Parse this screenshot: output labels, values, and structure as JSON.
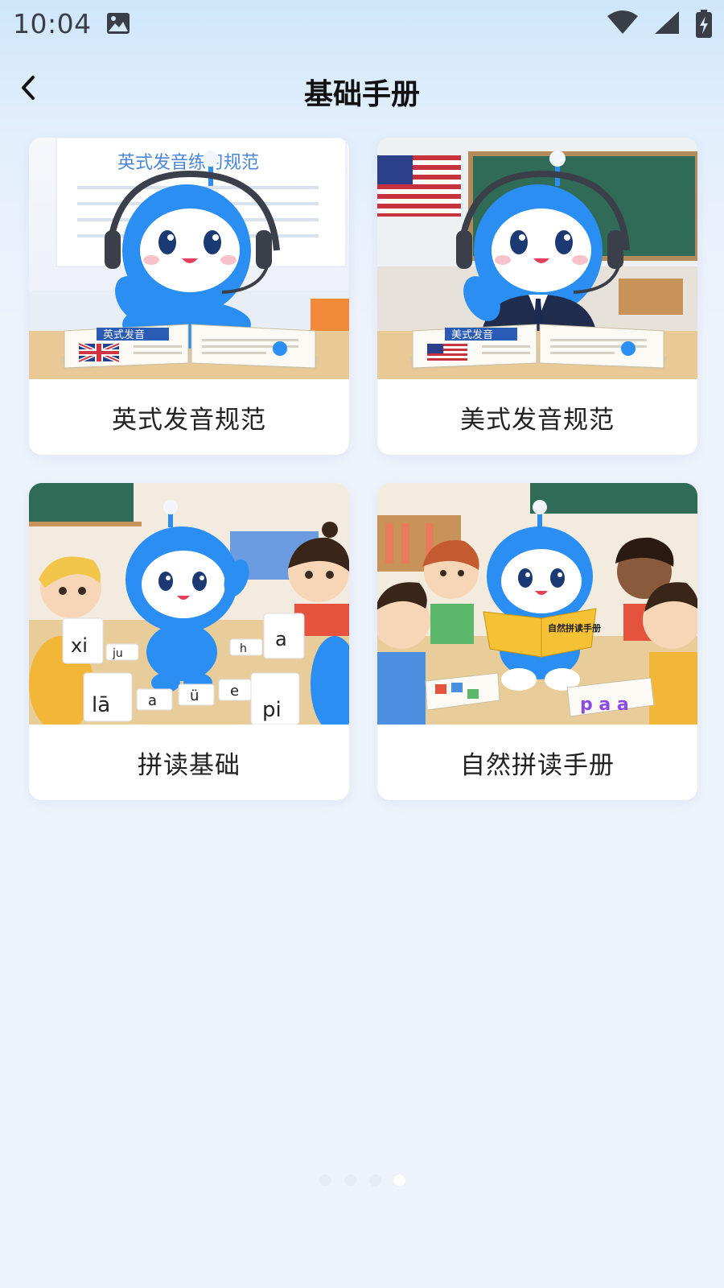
{
  "status_bar": {
    "time": "10:04",
    "icons": [
      "image-icon",
      "wifi-icon",
      "signal-icon",
      "battery-charging-icon"
    ]
  },
  "header": {
    "back_icon": "chevron-left-icon",
    "title": "基础手册"
  },
  "cards": [
    {
      "label": "英式发音规范",
      "image_text": {
        "title": "英式发音练习规范",
        "book_title": "英式发音"
      },
      "image_desc": "british-pronunciation-robot"
    },
    {
      "label": "美式发音规范",
      "image_text": {
        "book_title": "美式发音"
      },
      "image_desc": "american-pronunciation-robot"
    },
    {
      "label": "拼读基础",
      "image_text": {
        "cards": [
          "xi",
          "ju",
          "h",
          "a",
          "lā",
          "a",
          "ü",
          "e",
          "pi"
        ]
      },
      "image_desc": "pinyin-cards-robot"
    },
    {
      "label": "自然拼读手册",
      "image_text": {
        "book_title": "自然拼读手册",
        "letters": "p a a"
      },
      "image_desc": "phonics-reading-robot"
    }
  ],
  "pager": {
    "total": 4,
    "active_index": 3
  },
  "colors": {
    "robot_blue": "#2a8ef2",
    "background": "#eef3fb",
    "card": "#ffffff"
  }
}
